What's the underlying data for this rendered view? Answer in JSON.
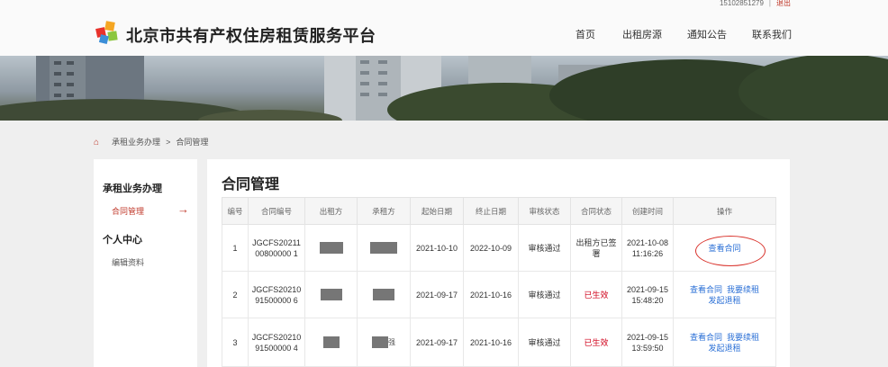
{
  "header": {
    "phone": "15102851279",
    "separator": "|",
    "logout": "退出",
    "site_title": "北京市共有产权住房租赁服务平台",
    "nav": [
      "首页",
      "出租房源",
      "通知公告",
      "联系我们"
    ]
  },
  "breadcrumb": {
    "section": "承租业务办理",
    "separator": ">",
    "current": "合同管理"
  },
  "sidebar": {
    "group1_title": "承租业务办理",
    "group1_item": "合同管理",
    "group1_arrow": "→",
    "group2_title": "个人中心",
    "group2_item": "编辑资料"
  },
  "main": {
    "title": "合同管理",
    "columns": [
      "编号",
      "合同编号",
      "出租方",
      "承租方",
      "起始日期",
      "终止日期",
      "审核状态",
      "合同状态",
      "创建时间",
      "操作"
    ],
    "rows": [
      {
        "no": "1",
        "code": "JGCFS2021100800000 1",
        "lessee_suffix": "",
        "start": "2021-10-10",
        "end": "2022-10-09",
        "audit": "审核通过",
        "status": "出租方已签署",
        "created": "2021-10-08 11:16:26",
        "action1": "查看合同"
      },
      {
        "no": "2",
        "code": "JGCFS2021091500000 6",
        "lessee_suffix": "",
        "start": "2021-09-17",
        "end": "2021-10-16",
        "audit": "审核通过",
        "status": "已生效",
        "created": "2021-09-15 15:48:20",
        "action1": "查看合同",
        "action2": "我要续租",
        "action3": "发起退租"
      },
      {
        "no": "3",
        "code": "JGCFS2021091500000 4",
        "lessee_suffix": "强",
        "start": "2021-09-17",
        "end": "2021-10-16",
        "audit": "审核通过",
        "status": "已生效",
        "created": "2021-09-15 13:59:50",
        "action1": "查看合同",
        "action2": "我要续租",
        "action3": "发起退租"
      }
    ]
  },
  "colors": {
    "accent_red": "#c0392b",
    "status_red": "#d0021b",
    "link_blue": "#2a6fd6"
  }
}
